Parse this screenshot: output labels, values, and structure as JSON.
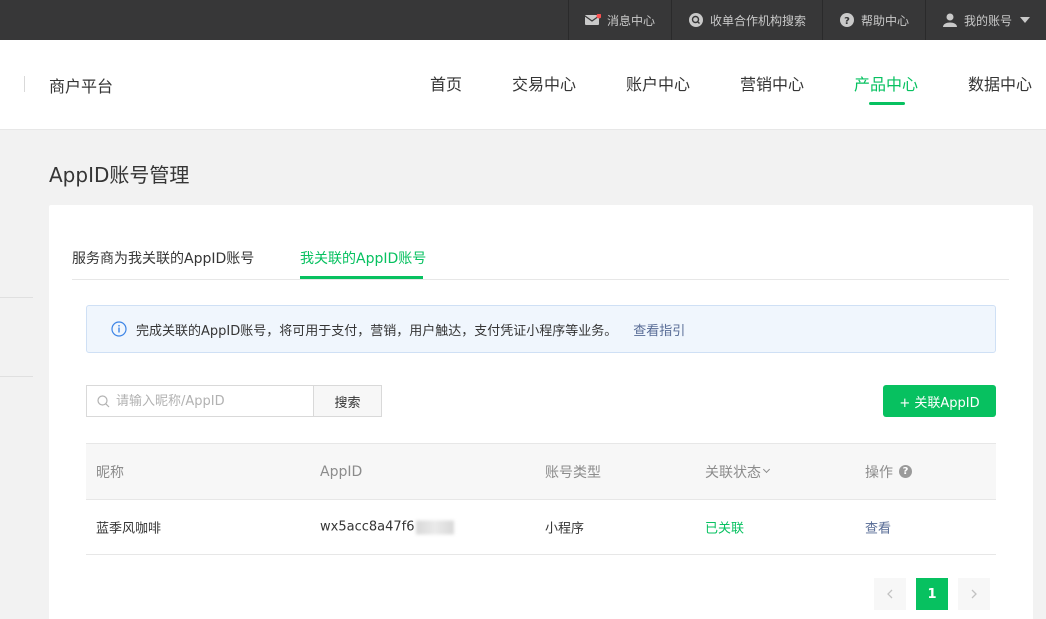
{
  "topbar": {
    "messages": "消息中心",
    "partner_search": "收单合作机构搜索",
    "help": "帮助中心",
    "account": "我的账号"
  },
  "header": {
    "brand": "商户平台",
    "nav": [
      "首页",
      "交易中心",
      "账户中心",
      "营销中心",
      "产品中心",
      "数据中心"
    ],
    "active_nav": "产品中心"
  },
  "page": {
    "title": "AppID账号管理"
  },
  "tabs": {
    "items": [
      "服务商为我关联的AppID账号",
      "我关联的AppID账号"
    ],
    "active": "我关联的AppID账号"
  },
  "notice": {
    "text": "完成关联的AppID账号，将可用于支付，营销，用户触达，支付凭证小程序等业务。",
    "link": "查看指引"
  },
  "search": {
    "placeholder": "请输入昵称/AppID",
    "button": "搜索"
  },
  "add_button": "+ 关联AppID",
  "table": {
    "columns": [
      "昵称",
      "AppID",
      "账号类型",
      "关联状态",
      "操作"
    ],
    "rows": [
      {
        "nickname": "蓝季风咖啡",
        "appid": "wx5acc8a47f6",
        "type": "小程序",
        "status": "已关联",
        "action": "查看"
      }
    ]
  },
  "pagination": {
    "current": "1"
  },
  "colors": {
    "accent": "#07c160",
    "link": "#576b95",
    "topbar_bg": "#373738"
  }
}
